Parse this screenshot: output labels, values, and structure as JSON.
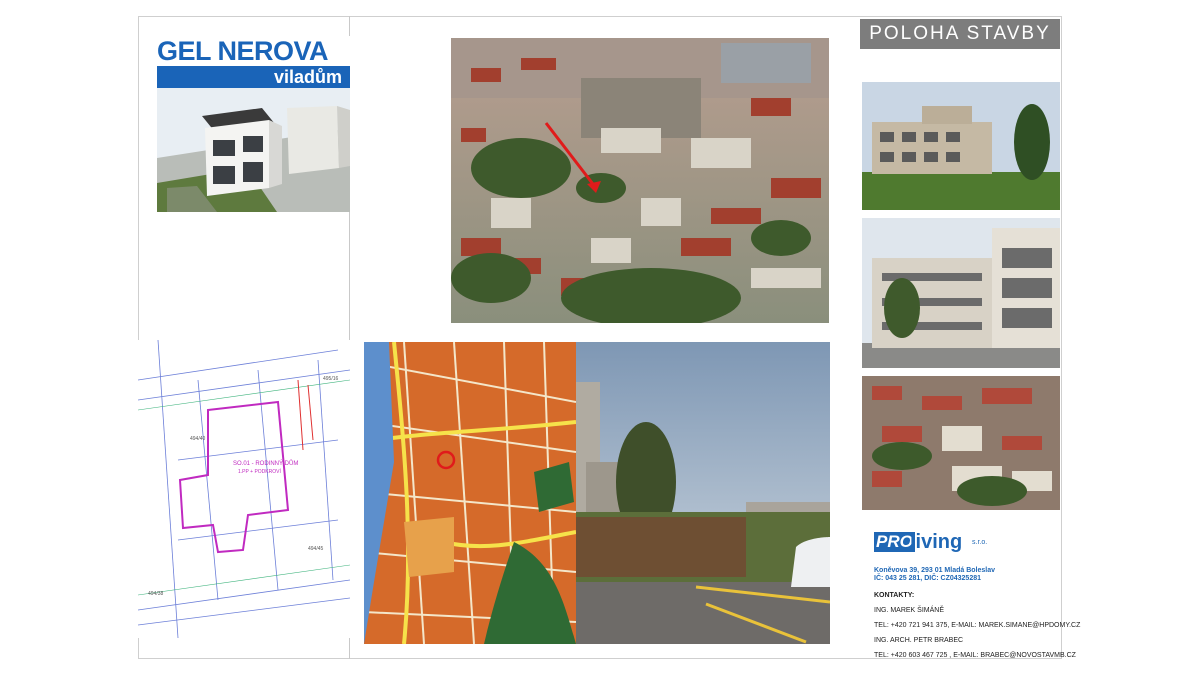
{
  "header": {
    "title": "POLOHA STAVBY"
  },
  "logo": {
    "main": "GEL NEROVA",
    "sub": "viladům"
  },
  "company": {
    "brand_box": "PRO",
    "brand_text": "living",
    "brand_suffix": "s.r.o.",
    "address_line1": "Koněvova 39, 293 01 Mladá Boleslav",
    "address_line2": "IČ: 043 25 281, DIČ: CZ04325281",
    "contacts_title": "KONTAKTY:",
    "contact1_name": "ING. MAREK ŠIMÁNĚ",
    "contact1_info": "TEL: +420 721 941 375, E-MAIL: MAREK.SIMANE@HPDOMY.CZ",
    "contact2_name": "ING. ARCH. PETR BRABEC",
    "contact2_info": "TEL: +420 603 467 725 , E-MAIL: BRABEC@NOVOSTAVMB.CZ"
  },
  "site_plan": {
    "house_label": "SO.01 - RODINNÝ DŮM",
    "house_sub": "1.PP + PODKROVÍ",
    "parcels": [
      "494/40",
      "494/38",
      "494/45",
      "495/16"
    ]
  },
  "colors": {
    "brand_blue": "#1a64b8",
    "title_gray": "#7d7d7d"
  }
}
